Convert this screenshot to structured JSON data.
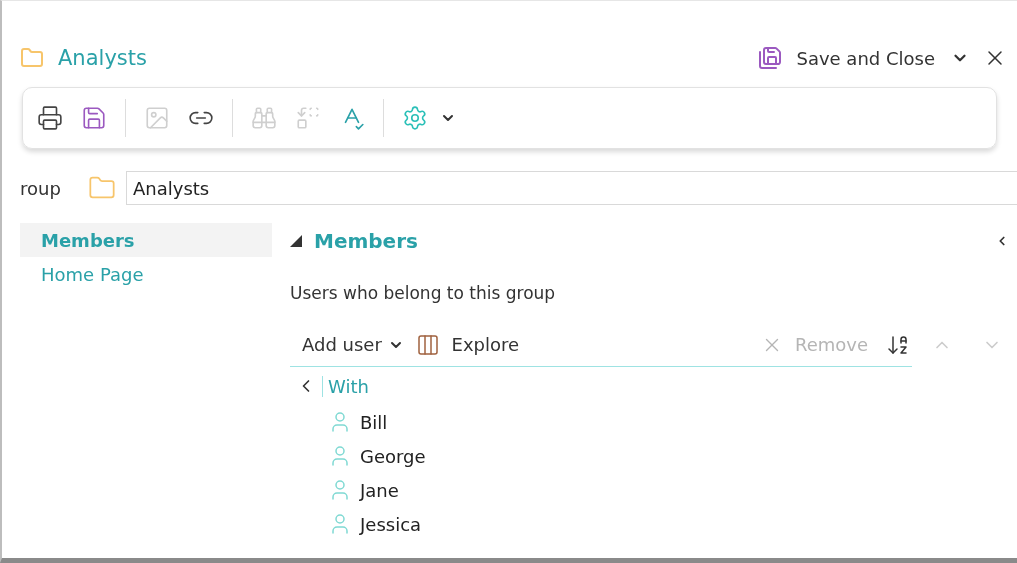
{
  "window": {
    "title": "Analysts",
    "save_button": "Save and Close"
  },
  "toolbar": [
    {
      "kind": "print",
      "disabled": false
    },
    {
      "kind": "save",
      "disabled": false
    },
    {
      "kind": "separator"
    },
    {
      "kind": "image",
      "disabled": true
    },
    {
      "kind": "link",
      "disabled": false
    },
    {
      "kind": "separator"
    },
    {
      "kind": "find",
      "disabled": true
    },
    {
      "kind": "replace",
      "disabled": true
    },
    {
      "kind": "spelling",
      "disabled": false
    },
    {
      "kind": "separator"
    },
    {
      "kind": "settings",
      "disabled": false
    }
  ],
  "group_field": {
    "label": "roup",
    "value": "Analysts"
  },
  "sidebar": {
    "items": [
      {
        "label": "Members",
        "selected": true
      },
      {
        "label": "Home Page",
        "selected": false
      }
    ]
  },
  "section": {
    "title": "Members",
    "expanded": true,
    "description": "Users who belong to this group"
  },
  "members_toolbar": {
    "add": "Add user",
    "explore": "Explore",
    "remove": "Remove",
    "remove_disabled": true
  },
  "tree": {
    "label": "With",
    "children": [
      {
        "label": "Bill"
      },
      {
        "label": "George"
      },
      {
        "label": "Jane"
      },
      {
        "label": "Jessica"
      }
    ]
  }
}
